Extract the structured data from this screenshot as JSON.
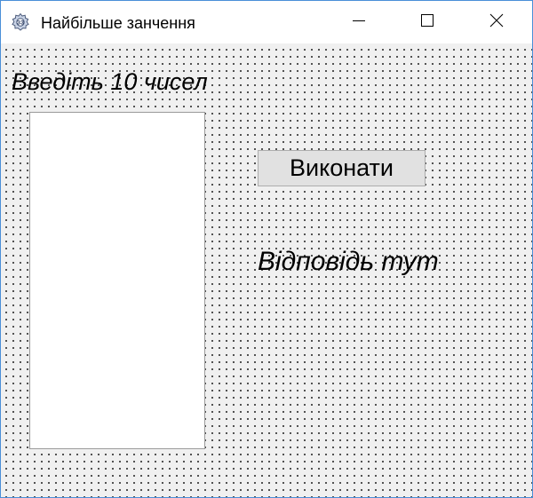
{
  "window": {
    "title": "Найбільше занчення",
    "icon": "app-gear-icon",
    "controls": [
      "minimize-icon",
      "maximize-icon",
      "close-icon"
    ]
  },
  "form": {
    "prompt_label": "Введіть 10 чисел",
    "run_button_label": "Виконати",
    "answer_label": "Відповідь тут",
    "number_list_items": []
  },
  "colors": {
    "client_background": "#f0f0f0",
    "grid_dots": "#3a3a3a",
    "button_face": "#e1e1e1",
    "window_border": "#4a8fd8"
  }
}
